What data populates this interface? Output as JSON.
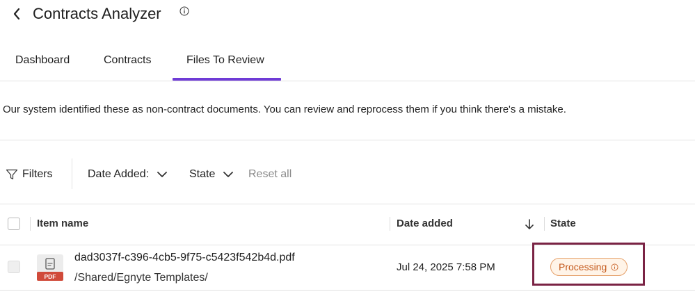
{
  "header": {
    "title": "Contracts Analyzer"
  },
  "tabs": [
    {
      "label": "Dashboard"
    },
    {
      "label": "Contracts"
    },
    {
      "label": "Files To Review"
    }
  ],
  "description": "Our system identified these as non-contract documents. You can review and reprocess them if you think there's a mistake.",
  "filters": {
    "filters_label": "Filters",
    "date_added_label": "Date Added:",
    "state_label": "State",
    "reset_label": "Reset all"
  },
  "table": {
    "columns": {
      "item_name": "Item name",
      "date_added": "Date added",
      "state": "State"
    },
    "rows": [
      {
        "file_type": "PDF",
        "name": "dad3037f-c396-4cb5-9f75-c5423f542b4d.pdf",
        "path": "/Shared/Egnyte Templates/",
        "date": "Jul 24, 2025 7:58 PM",
        "state": "Processing"
      }
    ]
  },
  "colors": {
    "accent": "#6f3bd6",
    "badge_text": "#c4581a",
    "badge_bg": "#fff4e8",
    "highlight": "#7a2344"
  }
}
